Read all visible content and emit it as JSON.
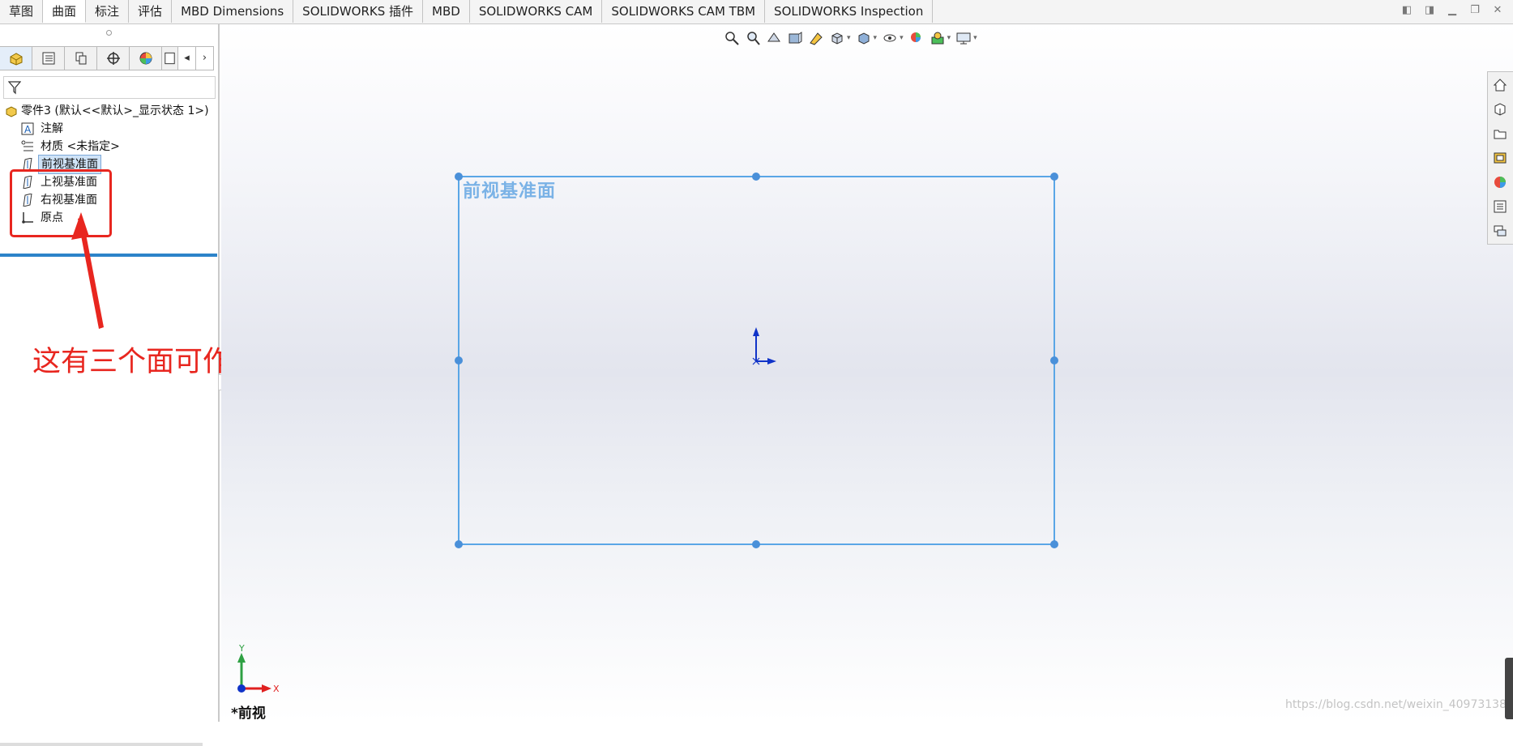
{
  "tabs": [
    "草图",
    "曲面",
    "标注",
    "评估",
    "MBD Dimensions",
    "SOLIDWORKS 插件",
    "MBD",
    "SOLIDWORKS CAM",
    "SOLIDWORKS CAM TBM",
    "SOLIDWORKS Inspection"
  ],
  "active_tab_index": 1,
  "window_controls": [
    "◧",
    "◨",
    "▁",
    "❐",
    "✕"
  ],
  "feature_tree": {
    "part": "零件3 (默认<<默认>_显示状态 1>)",
    "annotations": "注解",
    "material": "材质 <未指定>",
    "front_plane": "前视基准面",
    "top_plane": "上视基准面",
    "right_plane": "右视基准面",
    "origin": "原点"
  },
  "annotation_text": "这有三个面可作为基准面",
  "viewport": {
    "plane_label": "前视基准面",
    "view_name": "*前视",
    "triad_x": "X",
    "triad_y": "Y",
    "watermark": "https://blog.csdn.net/weixin_40973138"
  },
  "colors": {
    "accent": "#2c83c9",
    "plane_outline": "#5aa6e6",
    "annotation_red": "#e8261f"
  }
}
